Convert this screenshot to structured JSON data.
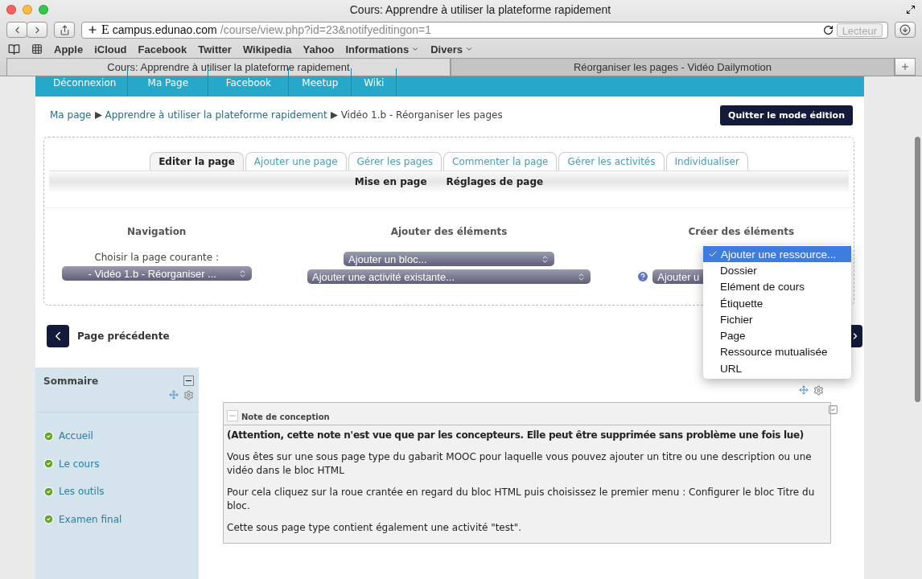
{
  "window": {
    "title": "Cours: Apprendre à utiliser la plateforme rapidement"
  },
  "toolbar": {
    "site_icon": "E",
    "url_host": "campus.edunao.com",
    "url_path": "/course/view.php?id=23&notifyeditingon=1",
    "reader_button": "Lecteur"
  },
  "bookmarks": [
    {
      "label": "Apple",
      "menu": false
    },
    {
      "label": "iCloud",
      "menu": false
    },
    {
      "label": "Facebook",
      "menu": false
    },
    {
      "label": "Twitter",
      "menu": false
    },
    {
      "label": "Wikipedia",
      "menu": false
    },
    {
      "label": "Yahoo",
      "menu": false
    },
    {
      "label": "Informations",
      "menu": true
    },
    {
      "label": "Divers",
      "menu": true
    }
  ],
  "browser_tabs": [
    {
      "label": "Cours: Apprendre à utiliser la plateforme rapidement",
      "selected": true
    },
    {
      "label": "Réorganiser les pages - Vidéo Dailymotion",
      "selected": false
    }
  ],
  "site_nav": [
    "Déconnexion",
    "Ma Page",
    "Facebook",
    "Meetup",
    "Wiki"
  ],
  "breadcrumb": {
    "links": [
      "Ma page",
      "Apprendre à utiliser la plateforme rapidement"
    ],
    "current": "Vidéo 1.b - Réorganiser les pages"
  },
  "quit_button": "Quitter le mode édition",
  "edit_tabs": [
    {
      "label": "Editer la page",
      "selected": true
    },
    {
      "label": "Ajouter une page",
      "selected": false
    },
    {
      "label": "Gérer les pages",
      "selected": false
    },
    {
      "label": "Commenter la page",
      "selected": false
    },
    {
      "label": "Gérer les activités",
      "selected": false
    },
    {
      "label": "Individualiser",
      "selected": false
    }
  ],
  "sub_tabs": [
    "Mise en page",
    "Réglages de page"
  ],
  "navigation": {
    "title": "Navigation",
    "label": "Choisir la page courante :",
    "select": "- Vidéo 1.b - Réorganiser ..."
  },
  "add_elements": {
    "title": "Ajouter des éléments",
    "selects": [
      "Ajouter un bloc...",
      "Ajouter une activité existante..."
    ]
  },
  "create_elements": {
    "title": "Créer des éléments",
    "select": "Ajouter u"
  },
  "dropdown": [
    {
      "label": "Ajouter une ressource...",
      "selected": true
    },
    {
      "label": "Dossier",
      "selected": false
    },
    {
      "label": "Elément de cours",
      "selected": false
    },
    {
      "label": "Étiquette",
      "selected": false
    },
    {
      "label": "Fichier",
      "selected": false
    },
    {
      "label": "Page",
      "selected": false
    },
    {
      "label": "Ressource mutualisée",
      "selected": false
    },
    {
      "label": "URL",
      "selected": false
    }
  ],
  "prev_page": "Page précédente",
  "sidebar": {
    "title": "Sommaire",
    "items": [
      {
        "label": "Accueil",
        "done": true
      },
      {
        "label": "Le cours",
        "done": true
      },
      {
        "label": "Les outils",
        "done": true
      },
      {
        "label": "Examen final",
        "done": true
      }
    ]
  },
  "note": {
    "title": "Note de conception",
    "paragraphs": [
      {
        "kind": "warning",
        "text": "(Attention, cette note n'est vue que par les concepteurs. Elle peut être supprimée sans problème une fois lue)"
      },
      {
        "kind": "text",
        "text": "Vous êtes sur une sous page type du gabarit MOOC pour laquelle vous pouvez ajouter un titre ou une description ou une vidéo dans le bloc HTML"
      },
      {
        "kind": "text",
        "text": "Pour cela cliquez sur la roue crantée en regard du bloc HTML  puis choisissez le premier menu : Configurer le bloc Titre du bloc."
      },
      {
        "kind": "text",
        "text": "Cette sous page type contient également une activité \"test\"."
      }
    ]
  }
}
